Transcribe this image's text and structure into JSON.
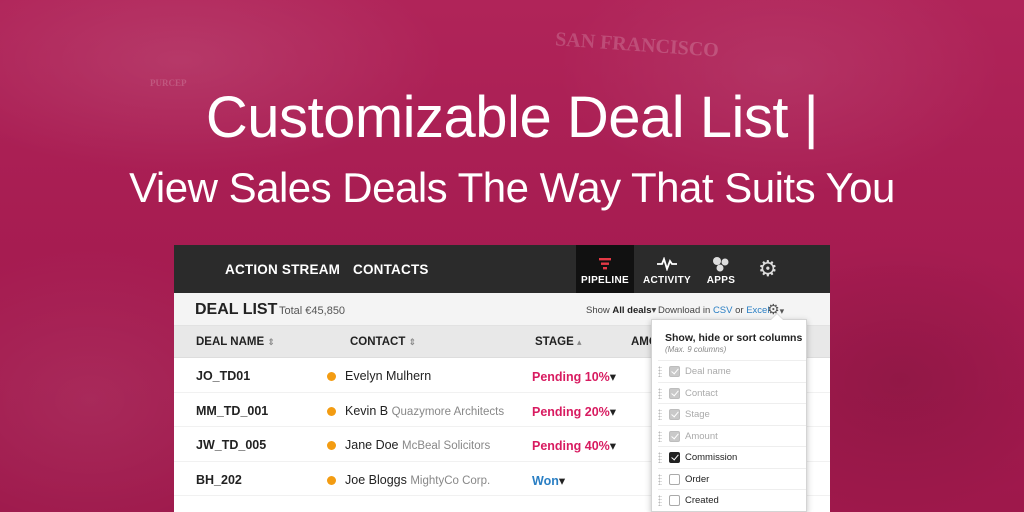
{
  "colors": {
    "background": "#a81c52",
    "nav_bg": "#2b2b2b",
    "stage_pending": "#d81b60",
    "stage_won": "#2a7fc4",
    "status_dot": "#f39c12",
    "link": "#2a7fc4"
  },
  "background_text": {
    "city": "SAN FRANCISCO",
    "sign": "PURCEP"
  },
  "headline": {
    "line1": "Customizable Deal List |",
    "line2": "View Sales Deals The Way That Suits You"
  },
  "nav": {
    "links": [
      "ACTION STREAM",
      "CONTACTS"
    ],
    "pipeline": {
      "label": "PIPELINE",
      "icon": "pipeline-funnel-icon"
    },
    "activity": {
      "label": "ACTIVITY",
      "icon": "activity-pulse-icon"
    },
    "apps": {
      "label": "APPS",
      "icon": "apps-bubbles-icon"
    },
    "settings": {
      "icon": "gear-icon"
    }
  },
  "deal_bar": {
    "title": "DEAL LIST",
    "total": "Total €45,850",
    "show_prefix": "Show",
    "show_value": "All deals",
    "download_prefix": "Download in",
    "csv": "CSV",
    "or": "or",
    "excel": "Excel"
  },
  "table": {
    "columns": [
      "DEAL NAME",
      "CONTACT",
      "STAGE",
      "AMO"
    ],
    "rows": [
      {
        "name": "JO_TD01",
        "contact": "Evelyn Mulhern",
        "org": "",
        "stage": "Pending 10%",
        "stage_type": "pending"
      },
      {
        "name": "MM_TD_001",
        "contact": "Kevin B",
        "org": "Quazymore Architects",
        "stage": "Pending 20%",
        "stage_type": "pending"
      },
      {
        "name": "JW_TD_005",
        "contact": "Jane Doe",
        "org": "McBeal Solicitors",
        "stage": "Pending 40%",
        "stage_type": "pending"
      },
      {
        "name": "BH_202",
        "contact": "Joe Bloggs",
        "org": "MightyCo Corp.",
        "stage": "Won",
        "stage_type": "won"
      }
    ]
  },
  "column_menu": {
    "title": "Show, hide or sort columns",
    "subtitle": "(Max. 9 columns)",
    "items": [
      {
        "label": "Deal name",
        "state": "locked"
      },
      {
        "label": "Contact",
        "state": "locked"
      },
      {
        "label": "Stage",
        "state": "locked"
      },
      {
        "label": "Amount",
        "state": "locked"
      },
      {
        "label": "Commission",
        "state": "checked"
      },
      {
        "label": "Order",
        "state": "unchecked"
      },
      {
        "label": "Created",
        "state": "unchecked"
      }
    ]
  }
}
